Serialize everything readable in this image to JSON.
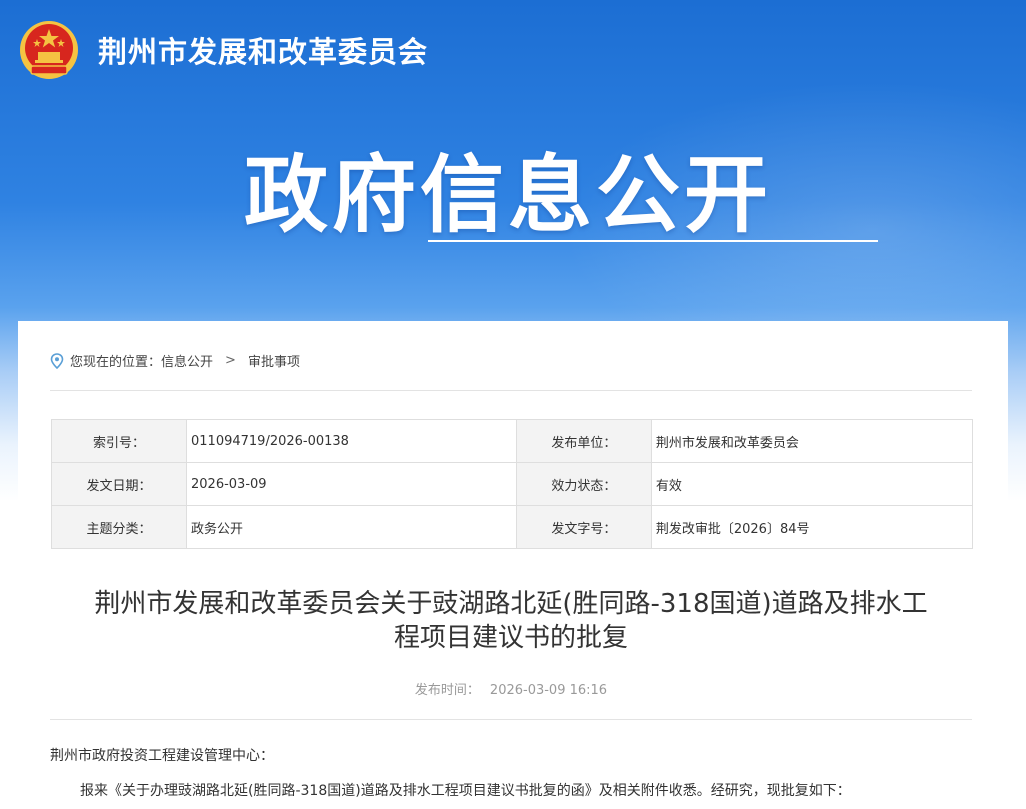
{
  "header": {
    "site_title": "荆州市发展和改革委员会",
    "hero_title": "政府信息公开"
  },
  "breadcrumb": {
    "prefix": "您现在的位置：",
    "items": [
      "信息公开",
      "审批事项"
    ],
    "separator": ">"
  },
  "meta": {
    "rows": [
      {
        "k1": "索引号：",
        "v1": "011094719/2026-00138",
        "k2": "发布单位：",
        "v2": "荆州市发展和改革委员会"
      },
      {
        "k1": "发文日期：",
        "v1": "2026-03-09",
        "k2": "效力状态：",
        "v2": "有效"
      },
      {
        "k1": "主题分类：",
        "v1": "政务公开",
        "k2": "发文字号：",
        "v2": "荆发改审批〔2026〕84号"
      }
    ]
  },
  "document": {
    "title_line1": "荆州市发展和改革委员会关于豉湖路北延(胜同路-318国道)道路及排水工",
    "title_line2": "程项目建议书的批复",
    "pub_label": "发布时间：",
    "pub_time": "2026-03-09 16:16",
    "addressee": "荆州市政府投资工程建设管理中心：",
    "para1": "报来《关于办理豉湖路北延(胜同路-318国道)道路及排水工程项目建议书批复的函》及相关附件收悉。经研究，现批复如下："
  },
  "colors": {
    "banner_top": "#1c6ed3",
    "emblem_red": "#d7261e",
    "emblem_gold": "#f5c342"
  }
}
